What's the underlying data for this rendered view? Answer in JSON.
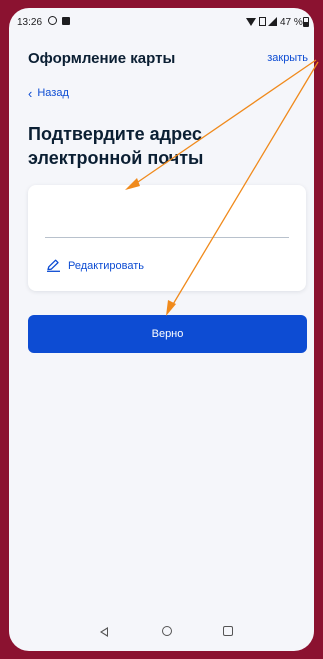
{
  "status_bar": {
    "time": "13:26",
    "battery": "47 %"
  },
  "header": {
    "title": "Оформление карты",
    "close_label": "закрыть"
  },
  "back_label": "Назад",
  "page_title": "Подтвердите адрес электронной почты",
  "email_field": {
    "value": "",
    "placeholder": ""
  },
  "edit_label": "Редактировать",
  "confirm_label": "Верно",
  "colors": {
    "accent": "#0d4cd3",
    "background": "#f5f6fa",
    "frame": "#8b1230",
    "annotation_arrow": "#f08a1c"
  },
  "icons": {
    "status": [
      "whatsapp-icon",
      "image-icon",
      "wifi-icon",
      "sim-icon",
      "signal-icon",
      "battery-icon"
    ],
    "edit": "pencil-icon",
    "back": "chevron-left-icon",
    "nav": [
      "nav-back-icon",
      "nav-home-icon",
      "nav-recents-icon"
    ]
  }
}
